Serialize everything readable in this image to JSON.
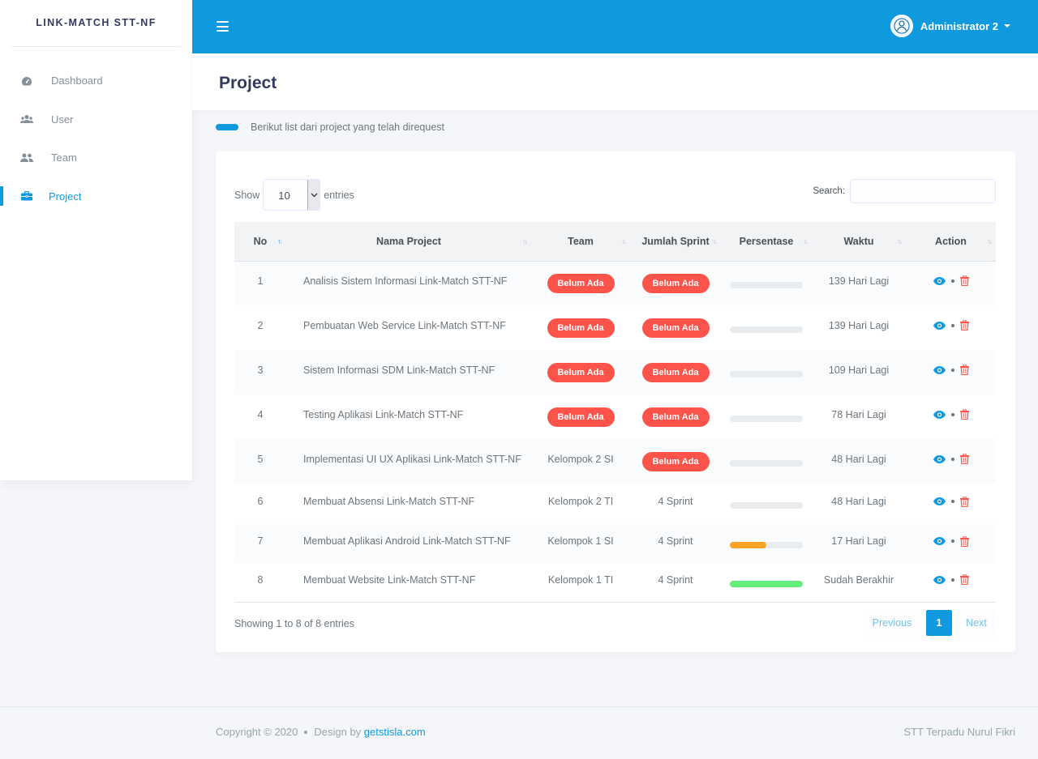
{
  "brand": "LINK-MATCH STT-NF",
  "navbar": {
    "user_name": "Administrator 2"
  },
  "sidebar": {
    "items": [
      {
        "label": "Dashboard",
        "icon": "dashboard-icon"
      },
      {
        "label": "User",
        "icon": "users-icon"
      },
      {
        "label": "Team",
        "icon": "team-icon"
      },
      {
        "label": "Project",
        "icon": "briefcase-icon",
        "active": true
      }
    ]
  },
  "page": {
    "title": "Project",
    "lead": "Berikut list dari project yang telah direquest"
  },
  "table_controls": {
    "show_label": "Show",
    "entries_label": "entries",
    "page_length": "10",
    "search_label": "Search:"
  },
  "table": {
    "columns": [
      "No",
      "Nama Project",
      "Team",
      "Jumlah Sprint",
      "Persentase",
      "Waktu",
      "Action"
    ],
    "rows": [
      {
        "no": "1",
        "name": "Analisis Sistem Informasi Link-Match STT-NF",
        "team": "Belum Ada",
        "team_badge": true,
        "sprint": "Belum Ada",
        "sprint_badge": true,
        "progress": 0,
        "waktu": "139 Hari Lagi"
      },
      {
        "no": "2",
        "name": "Pembuatan Web Service Link-Match STT-NF",
        "team": "Belum Ada",
        "team_badge": true,
        "sprint": "Belum Ada",
        "sprint_badge": true,
        "progress": 0,
        "waktu": "139 Hari Lagi"
      },
      {
        "no": "3",
        "name": "Sistem Informasi SDM Link-Match STT-NF",
        "team": "Belum Ada",
        "team_badge": true,
        "sprint": "Belum Ada",
        "sprint_badge": true,
        "progress": 0,
        "waktu": "109 Hari Lagi"
      },
      {
        "no": "4",
        "name": "Testing Aplikasi Link-Match STT-NF",
        "team": "Belum Ada",
        "team_badge": true,
        "sprint": "Belum Ada",
        "sprint_badge": true,
        "progress": 0,
        "waktu": "78 Hari Lagi"
      },
      {
        "no": "5",
        "name": "Implementasi UI UX Aplikasi Link-Match STT-NF",
        "team": "Kelompok 2 SI",
        "team_badge": false,
        "sprint": "Belum Ada",
        "sprint_badge": true,
        "progress": 0,
        "waktu": "48 Hari Lagi"
      },
      {
        "no": "6",
        "name": "Membuat Absensi Link-Match STT-NF",
        "team": "Kelompok 2 TI",
        "team_badge": false,
        "sprint": "4 Sprint",
        "sprint_badge": false,
        "progress": 0,
        "waktu": "48 Hari Lagi"
      },
      {
        "no": "7",
        "name": "Membuat Aplikasi Android Link-Match STT-NF",
        "team": "Kelompok 1 SI",
        "team_badge": false,
        "sprint": "4 Sprint",
        "sprint_badge": false,
        "progress": 50,
        "progress_color": "#ffa426",
        "waktu": "17 Hari Lagi"
      },
      {
        "no": "8",
        "name": "Membuat Website Link-Match STT-NF",
        "team": "Kelompok 1 TI",
        "team_badge": false,
        "sprint": "4 Sprint",
        "sprint_badge": false,
        "progress": 100,
        "progress_color": "#63ed7a",
        "waktu": "Sudah Berakhir"
      }
    ]
  },
  "table_info": "Showing 1 to 8 of 8 entries",
  "pagination": {
    "previous": "Previous",
    "current": "1",
    "next": "Next"
  },
  "footer": {
    "copyright": "Copyright © 2020",
    "design_by": "Design by",
    "design_link": "getstisla.com",
    "org": "STT Terpadu Nurul Fikri"
  },
  "colors": {
    "primary": "#0f9ae0",
    "danger": "#fc544b",
    "warning": "#ffa426",
    "success": "#63ed7a"
  }
}
